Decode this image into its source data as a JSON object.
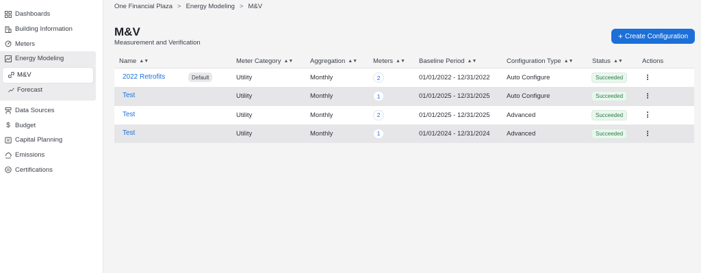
{
  "sidebar": {
    "items": [
      {
        "label": "Dashboards",
        "icon": "dashboards-icon"
      },
      {
        "label": "Building Information",
        "icon": "building-icon"
      },
      {
        "label": "Meters",
        "icon": "meters-icon"
      },
      {
        "label": "Energy Modeling",
        "icon": "energy-modeling-icon"
      },
      {
        "label": "Data Sources",
        "icon": "data-sources-icon"
      },
      {
        "label": "Budget",
        "icon": "dollar-icon"
      },
      {
        "label": "Capital Planning",
        "icon": "capital-planning-icon"
      },
      {
        "label": "Emissions",
        "icon": "emissions-icon"
      },
      {
        "label": "Certifications",
        "icon": "certifications-icon"
      }
    ],
    "sub_items": [
      {
        "label": "M&V",
        "icon": "link-icon"
      },
      {
        "label": "Forecast",
        "icon": "trend-icon"
      }
    ]
  },
  "breadcrumb": [
    "One Financial Plaza",
    "Energy Modeling",
    "M&V"
  ],
  "page": {
    "title": "M&V",
    "subtitle": "Measurement and Verification",
    "create_button": "Create Configuration"
  },
  "table": {
    "columns": [
      "Name",
      "Meter Category",
      "Aggregation",
      "Meters",
      "Baseline Period",
      "Configuration Type",
      "Status",
      "Actions"
    ],
    "rows": [
      {
        "name": "2022 Retrofits",
        "tag": "Default",
        "category": "Utility",
        "aggregation": "Monthly",
        "meters": "2",
        "period": "01/01/2022 - 12/31/2022",
        "config": "Auto Configure",
        "status": "Succeeded"
      },
      {
        "name": "Test",
        "tag": "",
        "category": "Utility",
        "aggregation": "Monthly",
        "meters": "1",
        "period": "01/01/2025 - 12/31/2025",
        "config": "Auto Configure",
        "status": "Succeeded"
      },
      {
        "name": "Test",
        "tag": "",
        "category": "Utility",
        "aggregation": "Monthly",
        "meters": "2",
        "period": "01/01/2025 - 12/31/2025",
        "config": "Advanced",
        "status": "Succeeded"
      },
      {
        "name": "Test",
        "tag": "",
        "category": "Utility",
        "aggregation": "Monthly",
        "meters": "1",
        "period": "01/01/2024 - 12/31/2024",
        "config": "Advanced",
        "status": "Succeeded"
      }
    ]
  },
  "colors": {
    "accent": "#1b6fd9",
    "status_success": "#2c7a43",
    "sidebar_bg": "#ffffff",
    "page_bg": "#f4f4f5"
  }
}
